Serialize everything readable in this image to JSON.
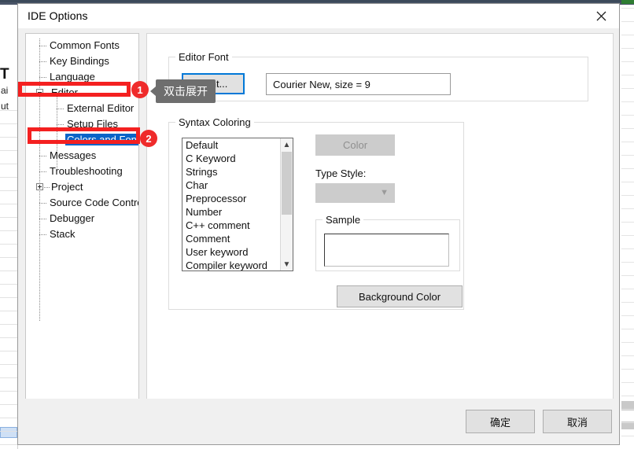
{
  "window": {
    "title": "IDE Options",
    "close_icon": "close-icon"
  },
  "tree": {
    "items": [
      {
        "label": "Common Fonts",
        "indent": 0,
        "toggle": "none",
        "selected": false
      },
      {
        "label": "Key Bindings",
        "indent": 0,
        "toggle": "none",
        "selected": false
      },
      {
        "label": "Language",
        "indent": 0,
        "toggle": "none",
        "selected": false
      },
      {
        "label": "Editor",
        "indent": 0,
        "toggle": "minus",
        "selected": false
      },
      {
        "label": "External Editor",
        "indent": 1,
        "toggle": "none",
        "selected": false
      },
      {
        "label": "Setup Files",
        "indent": 1,
        "toggle": "none",
        "selected": false
      },
      {
        "label": "Colors and Fonts",
        "indent": 1,
        "toggle": "none",
        "selected": true
      },
      {
        "label": "Messages",
        "indent": 0,
        "toggle": "none",
        "selected": false
      },
      {
        "label": "Troubleshooting",
        "indent": 0,
        "toggle": "none",
        "selected": false
      },
      {
        "label": "Project",
        "indent": 0,
        "toggle": "plus",
        "selected": false
      },
      {
        "label": "Source Code Contro",
        "indent": 0,
        "toggle": "none",
        "selected": false
      },
      {
        "label": "Debugger",
        "indent": 0,
        "toggle": "none",
        "selected": false
      },
      {
        "label": "Stack",
        "indent": 0,
        "toggle": "none",
        "selected": false
      }
    ],
    "scroll_left_icon": "chevron-left-icon",
    "scroll_right_icon": "chevron-right-icon"
  },
  "editor_font": {
    "group_label": "Editor Font",
    "font_button_label": "Font...",
    "font_value": "Courier New, size = 9"
  },
  "syntax_coloring": {
    "group_label": "Syntax Coloring",
    "items": [
      "Default",
      "C Keyword",
      "Strings",
      "Char",
      "Preprocessor",
      "Number",
      "C++ comment",
      "Comment",
      "User keyword",
      "Compiler keyword"
    ],
    "scroll_up_icon": "chevron-up-icon",
    "scroll_down_icon": "chevron-down-icon",
    "color_button_label": "Color",
    "color_button_disabled": true,
    "type_style_label": "Type Style:",
    "type_style_value": "",
    "type_style_disabled": true,
    "type_style_chevron_icon": "chevron-down-icon",
    "sample_group_label": "Sample",
    "sample_text": "",
    "background_color_button_label": "Background Color"
  },
  "footer": {
    "ok_label": "确定",
    "cancel_label": "取消"
  },
  "annotations": {
    "badge_one": "1",
    "badge_two": "2",
    "tooltip_text": "双击展开"
  },
  "colors": {
    "accent_blue": "#0078d7",
    "selection_blue": "#0a64c8",
    "annotation_red": "#f42020",
    "badge_red": "#ef2b2b",
    "tooltip_gray": "#6e6e6e",
    "dialog_bg": "#f0f0f0",
    "button_face": "#e1e1e1",
    "disabled_face": "#cccccc"
  },
  "background_app": {
    "texts": [
      "T",
      "ai",
      "ut"
    ]
  }
}
